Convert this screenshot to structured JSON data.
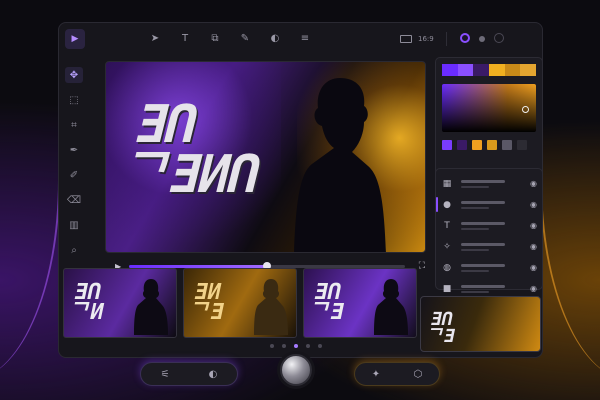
{
  "toolbar": {
    "aspect_ratio": "16:9",
    "tools": [
      {
        "icon": "pointer-icon",
        "glyph": "➤"
      },
      {
        "icon": "text-tool-icon",
        "glyph": "T"
      },
      {
        "icon": "layers-copy-icon",
        "glyph": "⧉"
      },
      {
        "icon": "pen-icon",
        "glyph": "✎"
      },
      {
        "icon": "palette-icon",
        "glyph": "◐"
      },
      {
        "icon": "adjust-sliders-icon",
        "glyph": "≡"
      }
    ]
  },
  "rail": [
    {
      "icon": "move-icon",
      "glyph": "✥",
      "active": true
    },
    {
      "icon": "marquee-select-icon",
      "glyph": "⬚",
      "active": false
    },
    {
      "icon": "crop-icon",
      "glyph": "⌗",
      "active": false
    },
    {
      "icon": "pen-icon",
      "glyph": "✒",
      "active": false
    },
    {
      "icon": "brush-icon",
      "glyph": "✐",
      "active": false
    },
    {
      "icon": "eraser-icon",
      "glyph": "⌫",
      "active": false
    },
    {
      "icon": "gradient-icon",
      "glyph": "▥",
      "active": false
    },
    {
      "icon": "zoom-icon",
      "glyph": "⌕",
      "active": false
    }
  ],
  "preview": {
    "headline_line1": "ƎՈ",
    "headline_line2": "ᄀƎИՈ",
    "progress": 0.5
  },
  "colors": {
    "accent_purple": "#8a4fff",
    "accent_orange": "#f0a020",
    "swatches_top": [
      "#6a2cff",
      "#8a4fff",
      "#3a1a66",
      "#f0b020",
      "#c88a18",
      "#e5a630"
    ],
    "swatches_bottom": [
      "#7a3cff",
      "#3a1a66",
      "#f0a020",
      "#d99a1c",
      "#5a5866",
      "#2c2b33"
    ]
  },
  "layers": [
    {
      "icon": "texture-icon",
      "glyph": "▦",
      "active": false
    },
    {
      "icon": "person-icon",
      "glyph": "●",
      "active": true
    },
    {
      "icon": "text-layer-icon",
      "glyph": "T",
      "active": false
    },
    {
      "icon": "sparkle-icon",
      "glyph": "✧",
      "active": false
    },
    {
      "icon": "blend-icon",
      "glyph": "◍",
      "active": false
    },
    {
      "icon": "solid-layer-icon",
      "glyph": "■",
      "active": false
    }
  ],
  "thumbnails": [
    {
      "text": "ƎՈ\nᄀИ",
      "style": "t1"
    },
    {
      "text": "ƎИ\nᄀƎ",
      "style": "t2"
    },
    {
      "text": "ƎՈ\nᄀƎ",
      "style": "t3"
    }
  ],
  "floating_thumb_text": "ƎՈ\nᄀƎ",
  "pager": {
    "count": 5,
    "active": 2
  },
  "dock": {
    "left": [
      {
        "icon": "sliders-icon",
        "glyph": "⚟"
      },
      {
        "icon": "filter-icon",
        "glyph": "◐"
      }
    ],
    "right": [
      {
        "icon": "magic-sparkle-icon",
        "glyph": "✦"
      },
      {
        "icon": "cube-icon",
        "glyph": "⬡"
      }
    ]
  }
}
